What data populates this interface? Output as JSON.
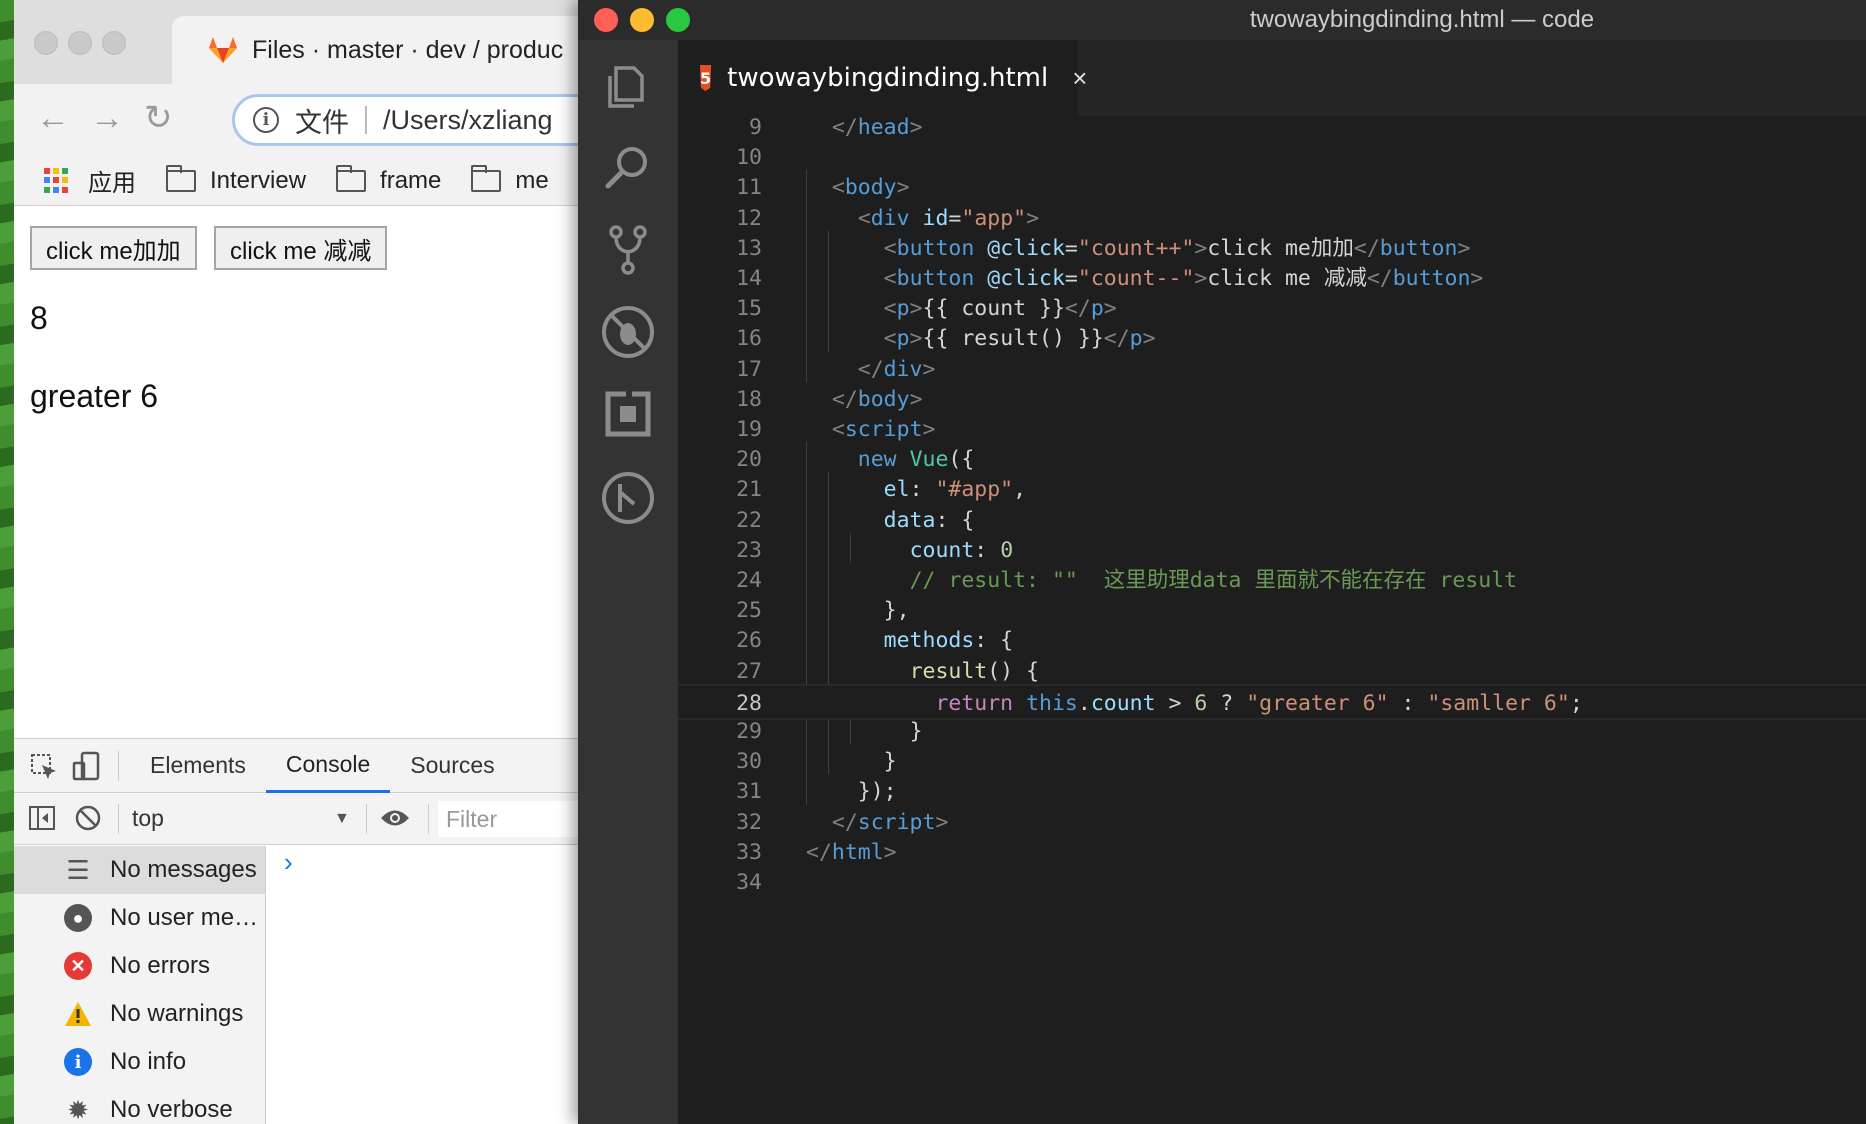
{
  "browser": {
    "tab_title": "Files · master · dev / produc",
    "tab_close": "x",
    "address_label": "文件",
    "address_text": "/Users/xzliang",
    "bookmarks": [
      {
        "label": "应用",
        "icon": "apps-grid-icon"
      },
      {
        "label": "Interview",
        "icon": "folder-icon"
      },
      {
        "label": "frame",
        "icon": "folder-icon"
      },
      {
        "label": "me",
        "icon": "folder-icon"
      }
    ],
    "page": {
      "button_increment": "click me加加",
      "button_decrement": "click me 减减",
      "count": "8",
      "result": "greater 6"
    },
    "devtools": {
      "tabs": [
        "Elements",
        "Console",
        "Sources"
      ],
      "active_tab": "Console",
      "context": "top",
      "filter_placeholder": "Filter",
      "sidebar": [
        {
          "label": "No messages",
          "icon": "list-icon"
        },
        {
          "label": "No user me…",
          "icon": "user-icon"
        },
        {
          "label": "No errors",
          "icon": "error-icon"
        },
        {
          "label": "No warnings",
          "icon": "warning-icon"
        },
        {
          "label": "No info",
          "icon": "info-icon"
        },
        {
          "label": "No verbose",
          "icon": "bug-icon"
        }
      ],
      "prompt": "›"
    }
  },
  "editor": {
    "window_title": "twowaybingdinding.html — code",
    "tab_name": "twowaybingdinding.html",
    "tab_close": "×",
    "file_icon": "html5-icon",
    "current_line": 28,
    "lines": [
      {
        "n": "9",
        "tokens": [
          [
            "i2",
            ""
          ],
          [
            "brk",
            "</"
          ],
          [
            "tag",
            "head"
          ],
          [
            "brk",
            ">"
          ]
        ]
      },
      {
        "n": "10",
        "tokens": []
      },
      {
        "n": "11",
        "tokens": [
          [
            "i2",
            ""
          ],
          [
            "brk",
            "<"
          ],
          [
            "tag",
            "body"
          ],
          [
            "brk",
            ">"
          ]
        ]
      },
      {
        "n": "12",
        "tokens": [
          [
            "i4",
            ""
          ],
          [
            "brk",
            "<"
          ],
          [
            "tag",
            "div"
          ],
          [
            "txt",
            " "
          ],
          [
            "attr",
            "id"
          ],
          [
            "txt",
            "="
          ],
          [
            "str",
            "\"app\""
          ],
          [
            "brk",
            ">"
          ]
        ]
      },
      {
        "n": "13",
        "tokens": [
          [
            "i6",
            ""
          ],
          [
            "brk",
            "<"
          ],
          [
            "tag",
            "button"
          ],
          [
            "txt",
            " "
          ],
          [
            "attr",
            "@click"
          ],
          [
            "txt",
            "="
          ],
          [
            "str",
            "\"count++\""
          ],
          [
            "brk",
            ">"
          ],
          [
            "txt",
            "click me加加"
          ],
          [
            "brk",
            "</"
          ],
          [
            "tag",
            "button"
          ],
          [
            "brk",
            ">"
          ]
        ]
      },
      {
        "n": "14",
        "tokens": [
          [
            "i6",
            ""
          ],
          [
            "brk",
            "<"
          ],
          [
            "tag",
            "button"
          ],
          [
            "txt",
            " "
          ],
          [
            "attr",
            "@click"
          ],
          [
            "txt",
            "="
          ],
          [
            "str",
            "\"count--\""
          ],
          [
            "brk",
            ">"
          ],
          [
            "txt",
            "click me 减减"
          ],
          [
            "brk",
            "</"
          ],
          [
            "tag",
            "button"
          ],
          [
            "brk",
            ">"
          ]
        ]
      },
      {
        "n": "15",
        "tokens": [
          [
            "i6",
            ""
          ],
          [
            "brk",
            "<"
          ],
          [
            "tag",
            "p"
          ],
          [
            "brk",
            ">"
          ],
          [
            "txt",
            "{{ count }}"
          ],
          [
            "brk",
            "</"
          ],
          [
            "tag",
            "p"
          ],
          [
            "brk",
            ">"
          ]
        ]
      },
      {
        "n": "16",
        "tokens": [
          [
            "i6",
            ""
          ],
          [
            "brk",
            "<"
          ],
          [
            "tag",
            "p"
          ],
          [
            "brk",
            ">"
          ],
          [
            "txt",
            "{{ result() }}"
          ],
          [
            "brk",
            "</"
          ],
          [
            "tag",
            "p"
          ],
          [
            "brk",
            ">"
          ]
        ]
      },
      {
        "n": "17",
        "tokens": [
          [
            "i4",
            ""
          ],
          [
            "brk",
            "</"
          ],
          [
            "tag",
            "div"
          ],
          [
            "brk",
            ">"
          ]
        ]
      },
      {
        "n": "18",
        "tokens": [
          [
            "i2",
            ""
          ],
          [
            "brk",
            "</"
          ],
          [
            "tag",
            "body"
          ],
          [
            "brk",
            ">"
          ]
        ]
      },
      {
        "n": "19",
        "tokens": [
          [
            "i2",
            ""
          ],
          [
            "brk",
            "<"
          ],
          [
            "tag",
            "script"
          ],
          [
            "brk",
            ">"
          ]
        ]
      },
      {
        "n": "20",
        "tokens": [
          [
            "i4",
            ""
          ],
          [
            "kw",
            "new"
          ],
          [
            "txt",
            " "
          ],
          [
            "cls",
            "Vue"
          ],
          [
            "txt",
            "({"
          ]
        ]
      },
      {
        "n": "21",
        "tokens": [
          [
            "i6",
            ""
          ],
          [
            "prop",
            "el"
          ],
          [
            "txt",
            ": "
          ],
          [
            "str",
            "\"#app\""
          ],
          [
            "txt",
            ","
          ]
        ]
      },
      {
        "n": "22",
        "tokens": [
          [
            "i6",
            ""
          ],
          [
            "prop",
            "data"
          ],
          [
            "txt",
            ": {"
          ]
        ]
      },
      {
        "n": "23",
        "tokens": [
          [
            "i8",
            ""
          ],
          [
            "prop",
            "count"
          ],
          [
            "txt",
            ": "
          ],
          [
            "num",
            "0"
          ]
        ]
      },
      {
        "n": "24",
        "tokens": [
          [
            "i8",
            ""
          ],
          [
            "com",
            "// result: \"\"  这里助理data 里面就不能在存在 result"
          ]
        ]
      },
      {
        "n": "25",
        "tokens": [
          [
            "i6",
            ""
          ],
          [
            "txt",
            "},"
          ]
        ]
      },
      {
        "n": "26",
        "tokens": [
          [
            "i6",
            ""
          ],
          [
            "prop",
            "methods"
          ],
          [
            "txt",
            ": {"
          ]
        ]
      },
      {
        "n": "27",
        "tokens": [
          [
            "i8",
            ""
          ],
          [
            "fn",
            "result"
          ],
          [
            "txt",
            "() {"
          ]
        ]
      },
      {
        "n": "28",
        "tokens": [
          [
            "i10",
            ""
          ],
          [
            "kwc",
            "return"
          ],
          [
            "txt",
            " "
          ],
          [
            "kw",
            "this"
          ],
          [
            "txt",
            "."
          ],
          [
            "prop",
            "count"
          ],
          [
            "txt",
            " > "
          ],
          [
            "num",
            "6"
          ],
          [
            "txt",
            " ? "
          ],
          [
            "str",
            "\"greater 6\""
          ],
          [
            "txt",
            " : "
          ],
          [
            "str",
            "\"samller 6\""
          ],
          [
            "txt",
            ";"
          ]
        ]
      },
      {
        "n": "29",
        "tokens": [
          [
            "i8",
            ""
          ],
          [
            "txt",
            "}"
          ]
        ]
      },
      {
        "n": "30",
        "tokens": [
          [
            "i6",
            ""
          ],
          [
            "txt",
            "}"
          ]
        ]
      },
      {
        "n": "31",
        "tokens": [
          [
            "i4",
            ""
          ],
          [
            "txt",
            "});"
          ]
        ]
      },
      {
        "n": "32",
        "tokens": [
          [
            "i2",
            ""
          ],
          [
            "brk",
            "</"
          ],
          [
            "tag",
            "script"
          ],
          [
            "brk",
            ">"
          ]
        ]
      },
      {
        "n": "33",
        "tokens": [
          [
            "brk",
            "</"
          ],
          [
            "tag",
            "html"
          ],
          [
            "brk",
            ">"
          ]
        ]
      },
      {
        "n": "34",
        "tokens": []
      }
    ]
  },
  "colors": {
    "vscode_bg": "#1e1e1e",
    "activity_bar": "#333333",
    "html_tag": "#569cd6",
    "string": "#ce9178",
    "comment": "#6a9955",
    "devtools_accent": "#1a73e8",
    "close_dot": "#ff5f57",
    "minimize_dot": "#febc2e",
    "zoom_dot": "#28c840"
  }
}
